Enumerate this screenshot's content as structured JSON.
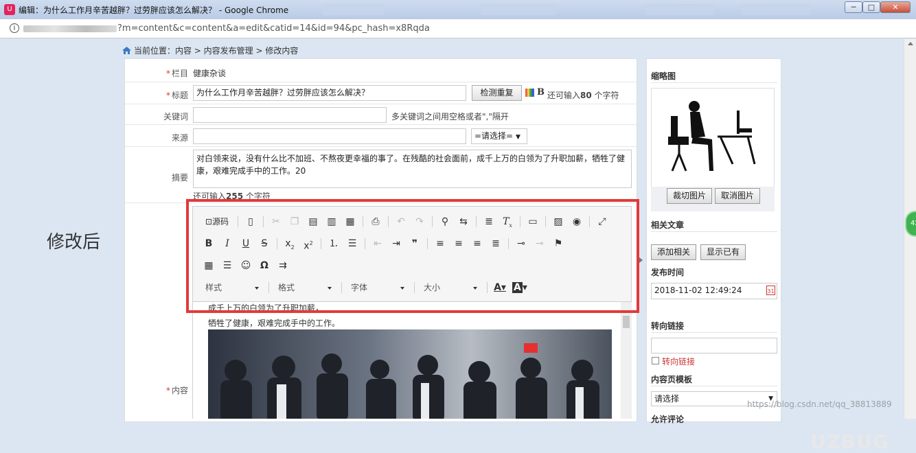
{
  "window": {
    "title": "编辑：为什么工作月辛苦越胖？过劳胖应该怎么解决？ - Google Chrome",
    "app_icon": "U",
    "minimize": "─",
    "maximize": "□",
    "close": "✕"
  },
  "address": {
    "url": "?m=content&c=content&a=edit&catid=14&id=94&pc_hash=x8Rqda"
  },
  "breadcrumb": "当前位置：内容 > 内容发布管理 > 修改内容",
  "annotation": "修改后",
  "form": {
    "column": {
      "label": "栏目",
      "value": "健康杂谈"
    },
    "title": {
      "label": "标题",
      "value": "为什么工作月辛苦越胖？过劳胖应该怎么解决？",
      "check_button": "检测重复",
      "hint_prefix": "还可输入",
      "hint_count": "80",
      "hint_suffix": "个字符"
    },
    "keywords": {
      "label": "关键词",
      "value": "",
      "hint": "多关键词之间用空格或者\",\"隔开"
    },
    "source": {
      "label": "来源",
      "value": "",
      "select": "=请选择="
    },
    "summary": {
      "label": "摘要",
      "value": "对白领来说，没有什么比不加班、不熬夜更幸福的事了。在残酷的社会面前，成千上万的白领为了升职加薪，牺牲了健康，艰难完成手中的工作。20",
      "hint_prefix": "还可输入",
      "hint_count": "255",
      "hint_suffix": "个字符"
    },
    "content": {
      "label": "内容"
    }
  },
  "editor": {
    "source_label": "源码",
    "combos": {
      "style": "样式",
      "format": "格式",
      "font": "字体",
      "size": "大小"
    },
    "content_line1": "成千上万的白领为了升职加薪，",
    "content_line2": "牺牲了健康，艰难完成手中的工作。"
  },
  "side": {
    "thumb_header": "缩略图",
    "crop_button": "裁切图片",
    "cancel_button": "取消图片",
    "related_header": "相关文章",
    "add_related_button": "添加相关",
    "show_existing_button": "显示已有",
    "publish_time_header": "发布时间",
    "publish_time": "2018-11-02 12:49:24",
    "redirect_header": "转向链接",
    "redirect_checkbox_label": "转向链接",
    "template_header": "内容页模板",
    "template_select": "请选择",
    "comments_header": "允许评论"
  },
  "watermark": "https://blog.csdn.net/qq_38813889",
  "watermark2": "UZBUG",
  "colors": {
    "frame_red": "#e23a3a",
    "required_red": "#dd3333"
  }
}
